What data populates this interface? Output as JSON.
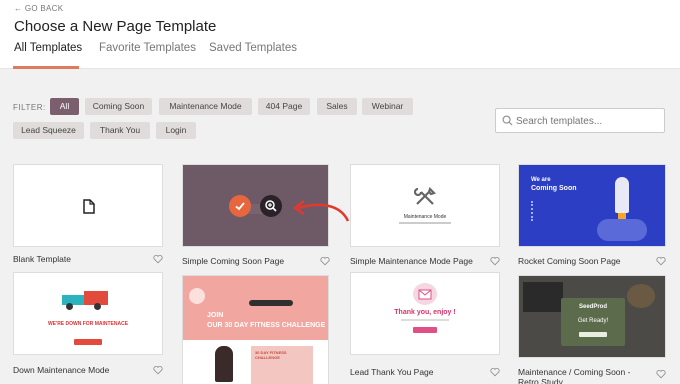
{
  "header": {
    "back_label": "← GO BACK",
    "title": "Choose a New Page Template",
    "tabs": [
      {
        "label": "All Templates",
        "active": true
      },
      {
        "label": "Favorite Templates",
        "active": false
      },
      {
        "label": "Saved Templates",
        "active": false
      }
    ]
  },
  "filter": {
    "label": "FILTER:",
    "chips": [
      "All",
      "Coming Soon",
      "Maintenance Mode",
      "404 Page",
      "Sales",
      "Webinar",
      "Lead Squeeze",
      "Thank You",
      "Login"
    ],
    "active": "All"
  },
  "search": {
    "placeholder": "Search templates..."
  },
  "templates": [
    {
      "label": "Blank Template"
    },
    {
      "label": "Simple Coming Soon Page"
    },
    {
      "label": "Simple Maintenance Mode Page",
      "thumb_text": "Maintenance Mode"
    },
    {
      "label": "Rocket Coming Soon Page",
      "thumb_title_1": "We are",
      "thumb_title_2": "Coming Soon"
    },
    {
      "label": "Down Maintenance Mode",
      "thumb_text": "WE'RE DOWN FOR MAINTENACE"
    },
    {
      "label": "",
      "thumb_text_1": "JOIN",
      "thumb_text_2": "OUR 30 DAY FITNESS CHALLENGE",
      "thumb_text_3": "30 DAY FITNESS CHALLENGE"
    },
    {
      "label": "Lead Thank You Page",
      "thumb_text": "Thank you, enjoy !"
    },
    {
      "label": "Maintenance / Coming Soon - Retro Study",
      "thumb_brand": "SeedProd",
      "thumb_text": "Get Ready!"
    }
  ],
  "colors": {
    "accent": "#e07a5f",
    "chip_active": "#7b5f6e",
    "rocket_bg": "#2c3fc4"
  }
}
